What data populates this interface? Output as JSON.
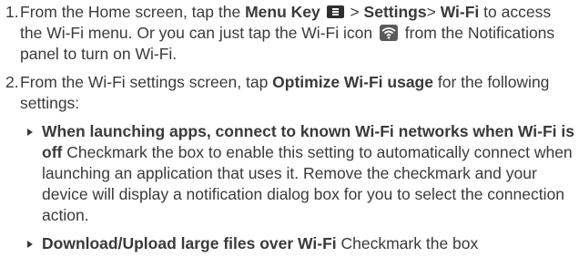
{
  "steps": [
    {
      "number": "1.",
      "t1": "From the Home screen, tap the ",
      "menu_key": "Menu Key",
      "t2": " > ",
      "settings": "Settings",
      "t3": "> ",
      "wifi": "Wi-Fi",
      "t4": " to access  the Wi-Fi menu. Or you can just tap the Wi-Fi icon ",
      "t5": " from the Notifications panel to turn on Wi-Fi."
    },
    {
      "number": "2.",
      "t1": "From the Wi-Fi settings screen, tap ",
      "optimize": "Optimize Wi-Fi usage",
      "t2": " for the following settings:"
    }
  ],
  "bullets": [
    {
      "title": "When launching apps, connect to known Wi-Fi networks when Wi-Fi is off",
      "text": "  Checkmark the box to enable this setting to automatically connect when launching an application that uses it. Remove the checkmark and your device will display a notification dialog box for you to select the connection action."
    },
    {
      "title": "Download/Upload large files over Wi-Fi",
      "text": "  Checkmark the box"
    }
  ],
  "icons": {
    "menu_key": "menu-key-icon",
    "wifi": "wifi-icon"
  }
}
